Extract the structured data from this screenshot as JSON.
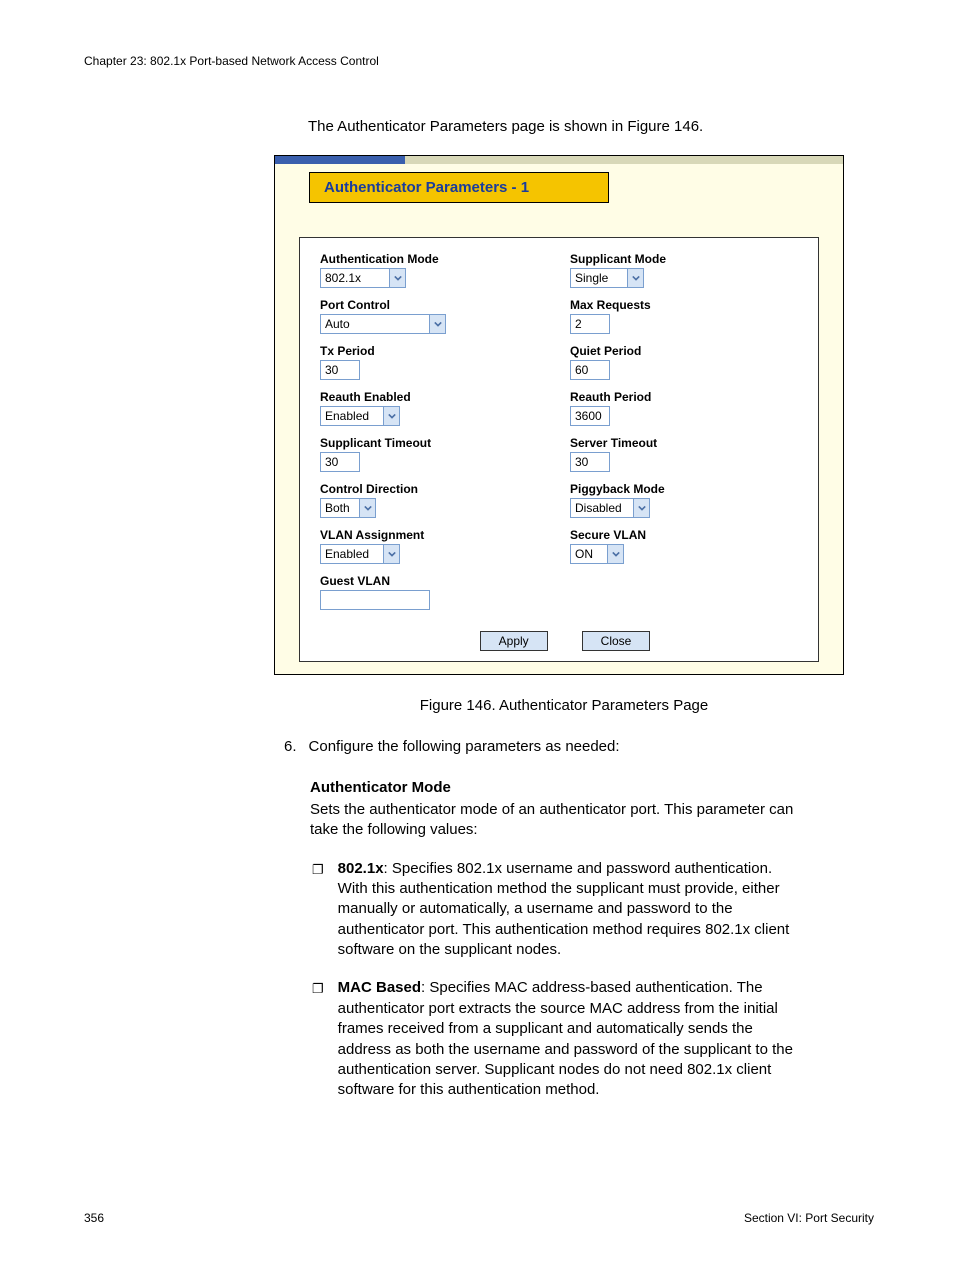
{
  "header": {
    "chapter": "Chapter 23: 802.1x Port-based Network Access Control"
  },
  "intro": "The Authenticator Parameters page is shown in Figure 146.",
  "panel": {
    "title": "Authenticator Parameters - 1",
    "left": {
      "auth_mode": {
        "label": "Authentication Mode",
        "value": "802.1x"
      },
      "port_control": {
        "label": "Port Control",
        "value": "Auto"
      },
      "tx_period": {
        "label": "Tx Period",
        "value": "30"
      },
      "reauth_enabled": {
        "label": "Reauth Enabled",
        "value": "Enabled"
      },
      "supp_timeout": {
        "label": "Supplicant Timeout",
        "value": "30"
      },
      "control_dir": {
        "label": "Control Direction",
        "value": "Both"
      },
      "vlan_assign": {
        "label": "VLAN Assignment",
        "value": "Enabled"
      },
      "guest_vlan": {
        "label": "Guest VLAN",
        "value": ""
      }
    },
    "right": {
      "supp_mode": {
        "label": "Supplicant Mode",
        "value": "Single"
      },
      "max_req": {
        "label": "Max Requests",
        "value": "2"
      },
      "quiet": {
        "label": "Quiet Period",
        "value": "60"
      },
      "reauth_period": {
        "label": "Reauth Period",
        "value": "3600"
      },
      "server_timeout": {
        "label": "Server Timeout",
        "value": "30"
      },
      "piggyback": {
        "label": "Piggyback Mode",
        "value": "Disabled"
      },
      "secure_vlan": {
        "label": "Secure VLAN",
        "value": "ON"
      }
    },
    "buttons": {
      "apply": "Apply",
      "close": "Close"
    }
  },
  "caption": "Figure 146. Authenticator Parameters Page",
  "step": {
    "num": "6.",
    "text": "Configure the following parameters as needed:"
  },
  "param": {
    "title": "Authenticator Mode",
    "desc": "Sets the authenticator mode of an authenticator port. This parameter can take the following values:"
  },
  "bullets": [
    {
      "lead": "802.1x",
      "body": ": Specifies 802.1x username and password authentication. With this authentication method the supplicant must provide, either manually or automatically, a username and password to the authenticator port. This authentication method requires 802.1x client software on the supplicant nodes."
    },
    {
      "lead": "MAC Based",
      "body": ": Specifies MAC address-based authentication. The authenticator port extracts the source MAC address from the initial frames received from a supplicant and automatically sends the address as both the username and password of the supplicant to the authentication server. Supplicant nodes do not need 802.1x client software for this authentication method."
    }
  ],
  "footer": {
    "page": "356",
    "section": "Section VI: Port Security"
  }
}
